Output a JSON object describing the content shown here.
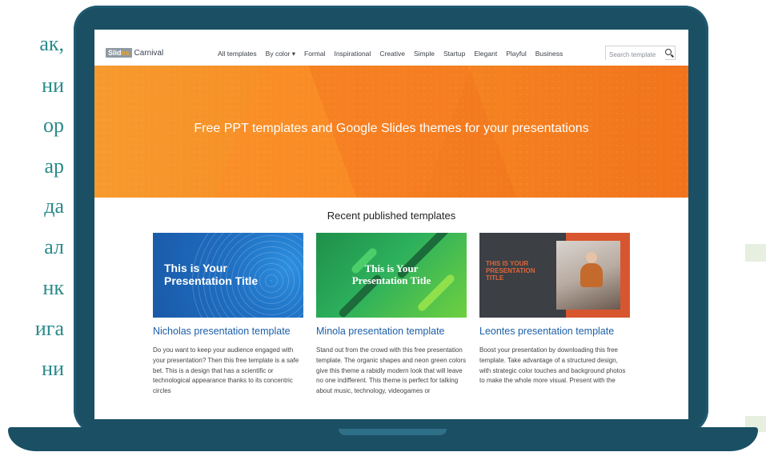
{
  "side_text": [
    "ак,",
    "ни",
    "ор",
    "ар",
    "да",
    "ал",
    "нк",
    "ига",
    "ни"
  ],
  "logo": {
    "slides": "Slides",
    "carnival": "Carnival"
  },
  "nav": {
    "items": [
      "All templates",
      "By color ▾",
      "Formal",
      "Inspirational",
      "Creative",
      "Simple",
      "Startup",
      "Elegant",
      "Playful",
      "Business"
    ],
    "search_placeholder": "Search template"
  },
  "hero": {
    "title": "Free PPT templates and Google Slides themes for your presentations"
  },
  "section": {
    "title": "Recent published templates"
  },
  "cards": [
    {
      "thumb_text": "This is Your\nPresentation Title",
      "title": "Nicholas presentation template",
      "desc": "Do you want to keep your audience engaged with your presentation? Then this free template is a safe bet. This is a design that has a scientific or technological appearance thanks to its concentric circles"
    },
    {
      "thumb_text": "This is Your\nPresentation Title",
      "title": "Minola presentation template",
      "desc": "Stand out from the crowd with this free presentation template. The organic shapes and neon green colors give this theme a rabidly modern look that will leave no one indifferent. This theme is perfect for talking about music, technology, videogames or"
    },
    {
      "thumb_text": "THIS IS YOUR PRESENTATION TITLE",
      "title": "Leontes presentation template",
      "desc": "Boost your presentation by downloading this free template. Take advantage of a structured design, with strategic color touches and background photos to make the whole more visual. Present with the"
    }
  ],
  "colors": {
    "hero": "#f58a22",
    "link": "#1c5fa8",
    "laptop": "#1a4f64",
    "side_text": "#2a8a8a"
  }
}
